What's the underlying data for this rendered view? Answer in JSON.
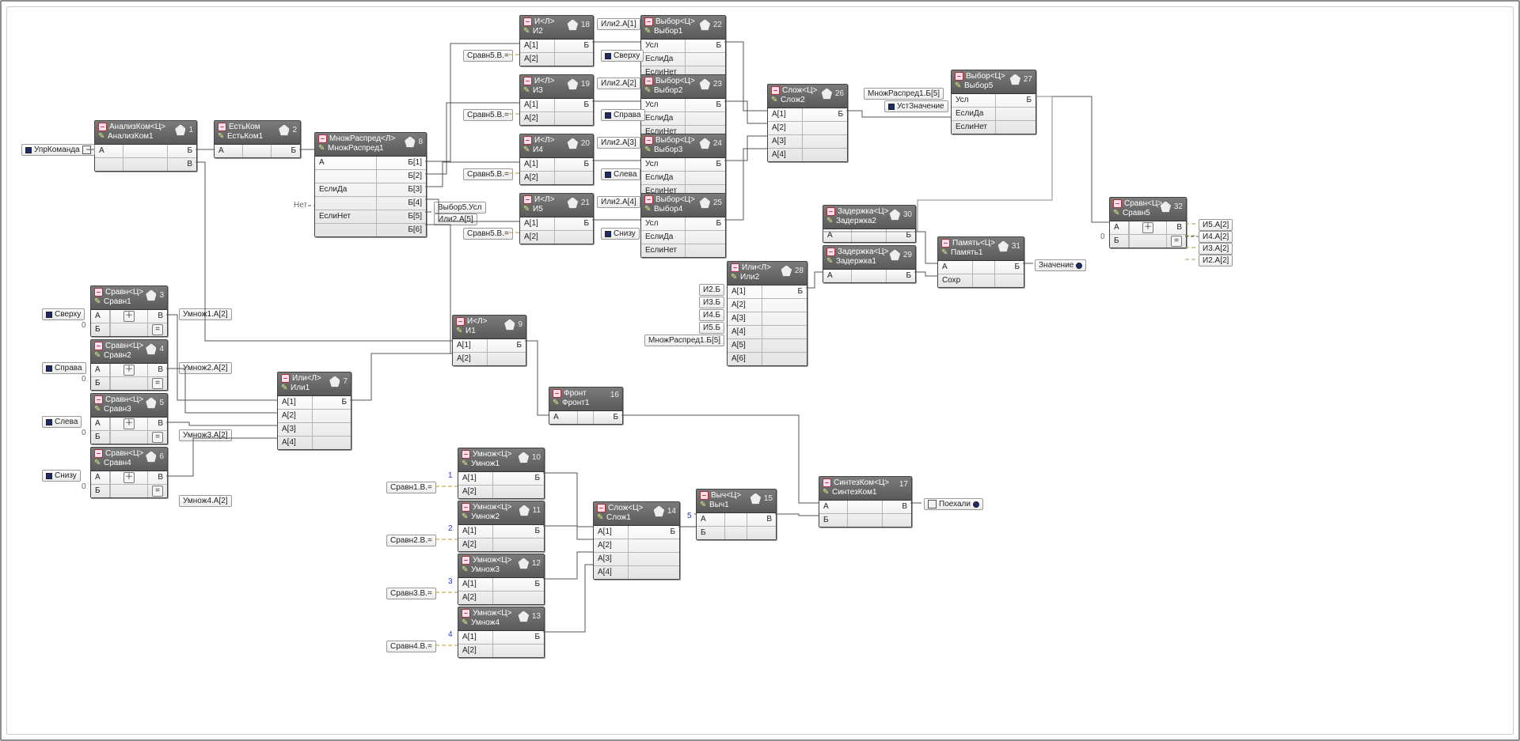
{
  "blocks": {
    "b1": {
      "type": "АнализКом<Ц>",
      "name": "АнализКом1",
      "idx": "1",
      "rows": [
        [
          "А",
          "",
          "Б"
        ],
        [
          " ",
          "",
          "В"
        ]
      ]
    },
    "b2": {
      "type": "ЕстьКом",
      "name": "ЕстьКом1",
      "idx": "2",
      "rows": [
        [
          "А",
          "",
          "Б"
        ]
      ]
    },
    "b3": {
      "type": "Сравн<Ц>",
      "name": "Сравн1",
      "idx": "3",
      "cmp": true
    },
    "b4": {
      "type": "Сравн<Ц>",
      "name": "Сравн2",
      "idx": "4",
      "cmp": true
    },
    "b5": {
      "type": "Сравн<Ц>",
      "name": "Сравн3",
      "idx": "5",
      "cmp": true
    },
    "b6": {
      "type": "Сравн<Ц>",
      "name": "Сравн4",
      "idx": "6",
      "cmp": true
    },
    "b7": {
      "type": "Или<Л>",
      "name": "Или1",
      "idx": "7",
      "rows": [
        [
          "А[1]",
          "Б"
        ],
        [
          "А[2]",
          ""
        ],
        [
          "А[3]",
          ""
        ],
        [
          "А[4]",
          ""
        ]
      ]
    },
    "b8": {
      "type": "МножРаспред<Л>",
      "name": "МножРаспред1",
      "idx": "8",
      "rows": [
        [
          "А",
          "Б[1]"
        ],
        [
          " ",
          "Б[2]"
        ],
        [
          "ЕслиДа",
          "Б[3]"
        ],
        [
          " ",
          "Б[4]"
        ],
        [
          "ЕслиНет",
          "Б[5]"
        ],
        [
          " ",
          "Б[6]"
        ]
      ]
    },
    "b9": {
      "type": "И<Л>",
      "name": "И1",
      "idx": "9",
      "rows": [
        [
          "А[1]",
          "Б"
        ],
        [
          "А[2]",
          ""
        ]
      ]
    },
    "b10": {
      "type": "Умнож<Ц>",
      "name": "Умнож1",
      "idx": "10",
      "rows": [
        [
          "А[1]",
          "Б"
        ],
        [
          "А[2]",
          ""
        ]
      ]
    },
    "b11": {
      "type": "Умнож<Ц>",
      "name": "Умнож2",
      "idx": "11",
      "rows": [
        [
          "А[1]",
          "Б"
        ],
        [
          "А[2]",
          ""
        ]
      ]
    },
    "b12": {
      "type": "Умнож<Ц>",
      "name": "Умнож3",
      "idx": "12",
      "rows": [
        [
          "А[1]",
          "Б"
        ],
        [
          "А[2]",
          ""
        ]
      ]
    },
    "b13": {
      "type": "Умнож<Ц>",
      "name": "Умнож4",
      "idx": "13",
      "rows": [
        [
          "А[1]",
          "Б"
        ],
        [
          "А[2]",
          ""
        ]
      ]
    },
    "b14": {
      "type": "Слож<Ц>",
      "name": "Слож1",
      "idx": "14",
      "rows": [
        [
          "А[1]",
          "Б"
        ],
        [
          "А[2]",
          ""
        ],
        [
          "А[3]",
          ""
        ],
        [
          "А[4]",
          ""
        ]
      ]
    },
    "b15": {
      "type": "Выч<Ц>",
      "name": "Выч1",
      "idx": "15",
      "rows": [
        [
          "А",
          "",
          "В"
        ],
        [
          "Б",
          "",
          ""
        ]
      ]
    },
    "b16": {
      "type": "Фронт",
      "name": "Фронт1",
      "idx": "16",
      "rows": [
        [
          "А",
          "",
          "Б"
        ]
      ]
    },
    "b17": {
      "type": "СинтезКом<Ц>",
      "name": "СинтезКом1",
      "idx": "17",
      "rows": [
        [
          "А",
          "",
          "В"
        ],
        [
          "Б",
          "",
          ""
        ]
      ]
    },
    "b18": {
      "type": "И<Л>",
      "name": "И2",
      "idx": "18",
      "rows": [
        [
          "А[1]",
          "Б"
        ],
        [
          "А[2]",
          ""
        ]
      ]
    },
    "b19": {
      "type": "И<Л>",
      "name": "И3",
      "idx": "19",
      "rows": [
        [
          "А[1]",
          "Б"
        ],
        [
          "А[2]",
          ""
        ]
      ]
    },
    "b20": {
      "type": "И<Л>",
      "name": "И4",
      "idx": "20",
      "rows": [
        [
          "А[1]",
          "Б"
        ],
        [
          "А[2]",
          ""
        ]
      ]
    },
    "b21": {
      "type": "И<Л>",
      "name": "И5",
      "idx": "21",
      "rows": [
        [
          "А[1]",
          "Б"
        ],
        [
          "А[2]",
          ""
        ]
      ]
    },
    "b22": {
      "type": "Выбор<Ц>",
      "name": "Выбор1",
      "idx": "22",
      "rows": [
        [
          "Усл",
          "Б"
        ],
        [
          "ЕслиДа",
          ""
        ],
        [
          "ЕслиНет",
          ""
        ]
      ]
    },
    "b23": {
      "type": "Выбор<Ц>",
      "name": "Выбор2",
      "idx": "23",
      "rows": [
        [
          "Усл",
          "Б"
        ],
        [
          "ЕслиДа",
          ""
        ],
        [
          "ЕслиНет",
          ""
        ]
      ]
    },
    "b24": {
      "type": "Выбор<Ц>",
      "name": "Выбор3",
      "idx": "24",
      "rows": [
        [
          "Усл",
          "Б"
        ],
        [
          "ЕслиДа",
          ""
        ],
        [
          "ЕслиНет",
          ""
        ]
      ]
    },
    "b25": {
      "type": "Выбор<Ц>",
      "name": "Выбор4",
      "idx": "25",
      "rows": [
        [
          "Усл",
          "Б"
        ],
        [
          "ЕслиДа",
          ""
        ],
        [
          "ЕслиНет",
          ""
        ]
      ]
    },
    "b26": {
      "type": "Слож<Ц>",
      "name": "Слож2",
      "idx": "26",
      "rows": [
        [
          "А[1]",
          "Б"
        ],
        [
          "А[2]",
          ""
        ],
        [
          "А[3]",
          ""
        ],
        [
          "А[4]",
          ""
        ]
      ]
    },
    "b27": {
      "type": "Выбор<Ц>",
      "name": "Выбор5",
      "idx": "27",
      "rows": [
        [
          "Усл",
          "Б"
        ],
        [
          "ЕслиДа",
          ""
        ],
        [
          "ЕслиНет",
          ""
        ]
      ]
    },
    "b28": {
      "type": "Или<Л>",
      "name": "Или2",
      "idx": "28",
      "rows": [
        [
          "А[1]",
          "Б"
        ],
        [
          "А[2]",
          ""
        ],
        [
          "А[3]",
          ""
        ],
        [
          "А[4]",
          ""
        ],
        [
          "А[5]",
          ""
        ],
        [
          "А[6]",
          ""
        ]
      ]
    },
    "b29": {
      "type": "Задержка<Ц>",
      "name": "Задержка1",
      "idx": "29",
      "rows": [
        [
          "А",
          "",
          "Б"
        ]
      ]
    },
    "b30": {
      "type": "Задержка<Ц>",
      "name": "Задержка2",
      "idx": "30",
      "rows": [
        [
          "А",
          "",
          "Б"
        ]
      ]
    },
    "b31": {
      "type": "Память<Ц>",
      "name": "Память1",
      "idx": "31",
      "rows": [
        [
          "А",
          "",
          "Б"
        ],
        [
          "Сохр",
          "",
          ""
        ]
      ]
    },
    "b32": {
      "type": "Сравн<Ц>",
      "name": "Сравн5",
      "idx": "32",
      "cmp": true
    }
  },
  "pins": {
    "p_upr": {
      "text": "УпрКоманда",
      "side": "left"
    },
    "p_sverhu1": {
      "text": "Сверху",
      "side": "left"
    },
    "p_sprava1": {
      "text": "Справа",
      "side": "left"
    },
    "p_sleva1": {
      "text": "Слева",
      "side": "left"
    },
    "p_snizu1": {
      "text": "Снизу",
      "side": "left"
    },
    "p_sverhu2": {
      "text": "Сверху",
      "side": "left"
    },
    "p_sprava2": {
      "text": "Справа",
      "side": "left"
    },
    "p_sleva2": {
      "text": "Слева",
      "side": "left"
    },
    "p_snizu2": {
      "text": "Снизу",
      "side": "left"
    },
    "p_ustzn": {
      "text": "УстЗначение",
      "side": "left"
    },
    "p_znach": {
      "text": "Значение",
      "side": "right"
    },
    "p_poehali": {
      "text": "Поехали",
      "side": "right"
    }
  },
  "consts": {
    "c_net": {
      "text": "Нет",
      "cls": "grey"
    },
    "c_0a": {
      "text": "0",
      "cls": "grey"
    },
    "c_0b": {
      "text": "0",
      "cls": "grey"
    },
    "c_0c": {
      "text": "0",
      "cls": "grey"
    },
    "c_0d": {
      "text": "0",
      "cls": "grey"
    },
    "c_0e": {
      "text": "0",
      "cls": "grey"
    },
    "c_1": {
      "text": "1",
      "cls": "blue"
    },
    "c_2": {
      "text": "2",
      "cls": "blue"
    },
    "c_3": {
      "text": "3",
      "cls": "blue"
    },
    "c_4": {
      "text": "4",
      "cls": "blue"
    },
    "c_5": {
      "text": "5",
      "cls": "blue"
    }
  },
  "tags": {
    "t_um1": "Умнож1.А[2]",
    "t_um2": "Умнож2.А[2]",
    "t_um3": "Умнож3.А[2]",
    "t_um4": "Умнож4.А[2]",
    "t_sv1": "Сравн1.В.=",
    "t_sv2": "Сравн2.В.=",
    "t_sv3": "Сравн3.В.=",
    "t_sv4": "Сравн4.В.=",
    "t_sv5a": "Сравн5.В.=",
    "t_sv5b": "Сравн5.В.=",
    "t_sv5c": "Сравн5.В.=",
    "t_sv5d": "Сравн5.В.=",
    "t_ili2a1": "Или2.А[1]",
    "t_ili2a2": "Или2.А[2]",
    "t_ili2a3": "Или2.А[3]",
    "t_ili2a4": "Или2.А[4]",
    "t_ili2a5": "Или2.А[5]",
    "t_vyb5": "Выбор5.Усл",
    "t_i2b": "И2.Б",
    "t_i3b": "И3.Б",
    "t_i4b": "И4.Б",
    "t_i5b": "И5.Б",
    "t_mr5a": "МножРаспред1.Б[5]",
    "t_mr5b": "МножРаспред1.Б[5]",
    "t_i5a2": "И5.А[2]",
    "t_i4a2": "И4.А[2]",
    "t_i3a2": "И3.А[2]",
    "t_i2a2": "И2.А[2]"
  }
}
